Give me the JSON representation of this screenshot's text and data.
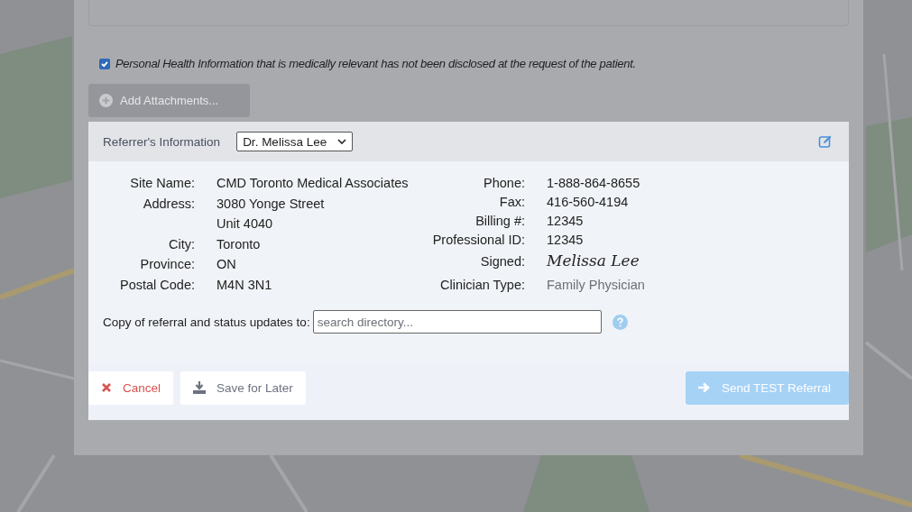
{
  "phi_notice": {
    "checked": true,
    "label": "Personal Health Information that is medically relevant has not been disclosed at the request of the patient."
  },
  "attach_button": {
    "label": "Add Attachments...",
    "disabled": true
  },
  "referrer": {
    "title": "Referrer's Information",
    "selected_doctor": "Dr. Melissa Lee",
    "left_fields": [
      {
        "label": "Site Name:",
        "value": "CMD Toronto Medical Associates"
      },
      {
        "label": "Address:",
        "value": "3080 Yonge Street"
      },
      {
        "value": "Unit 4040"
      },
      {
        "label": "City:",
        "value": "Toronto"
      },
      {
        "label": "Province:",
        "value": "ON"
      },
      {
        "label": "Postal Code:",
        "value": "M4N 3N1"
      }
    ],
    "right_fields": [
      {
        "label": "Phone:",
        "value": "1-888-864-8655",
        "kind": "text"
      },
      {
        "label": "Fax:",
        "value": "416-560-4194",
        "kind": "text"
      },
      {
        "label": "Billing #:",
        "value": "12345",
        "kind": "text"
      },
      {
        "label": "Professional ID:",
        "value": "12345",
        "kind": "text"
      },
      {
        "label": "Signed:",
        "value": "Melissa Lee",
        "kind": "signature"
      },
      {
        "label": "Clinician Type:",
        "value": "Family Physician",
        "kind": "muted"
      }
    ],
    "copy_label": "Copy of referral and status updates to:",
    "copy_placeholder": "search directory..."
  },
  "buttons": [
    {
      "label": "Cancel",
      "kind": "cancel",
      "disabled": false
    },
    {
      "label": "Save for Later",
      "kind": "save",
      "disabled": false
    },
    {
      "label": "Send TEST Referral",
      "kind": "send",
      "disabled": true
    }
  ]
}
